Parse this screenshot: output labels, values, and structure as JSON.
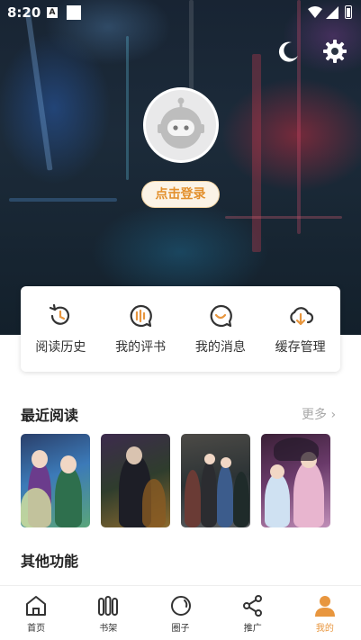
{
  "status_bar": {
    "time": "8:20",
    "notification_badge": "A"
  },
  "profile": {
    "login_label": "点击登录"
  },
  "quick_actions": [
    {
      "label": "阅读历史",
      "icon": "history-icon"
    },
    {
      "label": "我的评书",
      "icon": "comment-icon"
    },
    {
      "label": "我的消息",
      "icon": "message-icon"
    },
    {
      "label": "缓存管理",
      "icon": "cloud-cache-icon"
    }
  ],
  "recent": {
    "title": "最近阅读",
    "more_label": "更多 ›",
    "covers": [
      "comic-cover-1",
      "comic-cover-2",
      "comic-cover-3",
      "comic-cover-4"
    ]
  },
  "other": {
    "title": "其他功能"
  },
  "bottom_nav": [
    {
      "label": "首页",
      "icon": "home-icon",
      "active": false
    },
    {
      "label": "书架",
      "icon": "bookshelf-icon",
      "active": false
    },
    {
      "label": "圈子",
      "icon": "circle-icon",
      "active": false
    },
    {
      "label": "推广",
      "icon": "share-icon",
      "active": false
    },
    {
      "label": "我的",
      "icon": "profile-icon",
      "active": true
    }
  ],
  "colors": {
    "accent": "#e8963e",
    "login_text": "#e3902d",
    "muted": "#a8a8a8"
  }
}
